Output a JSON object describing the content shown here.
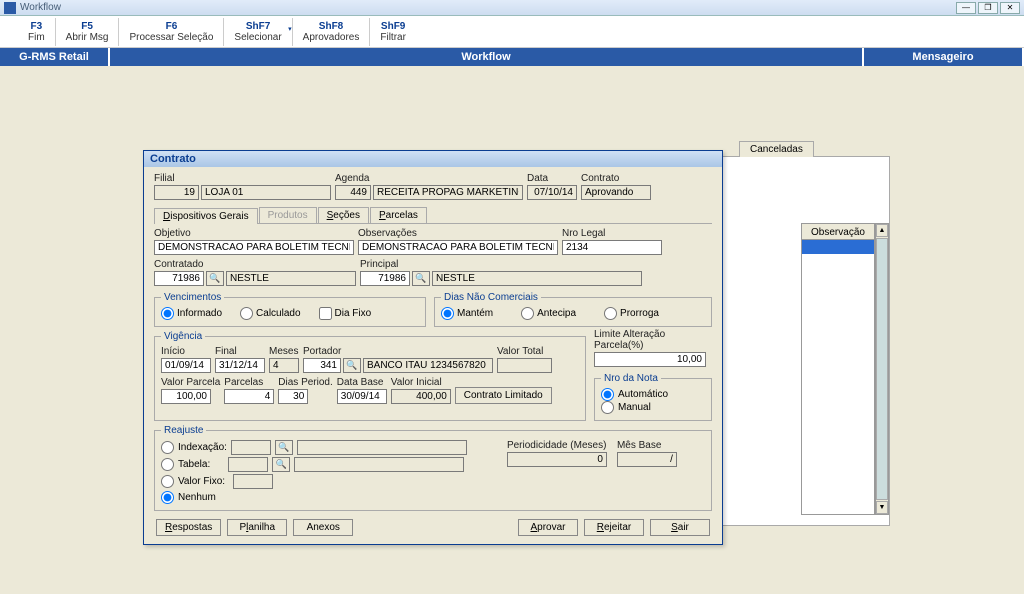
{
  "window": {
    "title": "Workflow"
  },
  "toolbar": [
    {
      "key": "F3",
      "label": "Fim"
    },
    {
      "key": "F5",
      "label": "Abrir Msg"
    },
    {
      "key": "F6",
      "label": "Processar Seleção"
    },
    {
      "key": "ShF7",
      "label": "Selecionar",
      "drop": true
    },
    {
      "key": "ShF8",
      "label": "Aprovadores"
    },
    {
      "key": "ShF9",
      "label": "Filtrar"
    }
  ],
  "bluebar": {
    "left": "G-RMS Retail",
    "middle": "Workflow",
    "right": "Mensageiro"
  },
  "bg": {
    "tab": "Canceladas",
    "col": "Observação"
  },
  "dialog": {
    "title": "Contrato",
    "header": {
      "filial_label": "Filial",
      "filial_code": "19",
      "filial_name": "LOJA 01",
      "agenda_label": "Agenda",
      "agenda_code": "449",
      "agenda_name": "RECEITA PROPAG MARKETING",
      "data_label": "Data",
      "data_value": "07/10/14",
      "contrato_label": "Contrato",
      "contrato_value": "Aprovando"
    },
    "tabs": {
      "t1": "Dispositivos Gerais",
      "t2": "Produtos",
      "t3": "Seções",
      "t4": "Parcelas"
    },
    "main": {
      "objetivo_label": "Objetivo",
      "objetivo": "DEMONSTRACAO PARA BOLETIM TECNICO",
      "obs_label": "Observações",
      "obs": "DEMONSTRACAO PARA BOLETIM TECNICO",
      "nrolegal_label": "Nro Legal",
      "nrolegal": "2134",
      "contratado_label": "Contratado",
      "contratado_code": "71986",
      "contratado_name": "NESTLE",
      "principal_label": "Principal",
      "principal_code": "71986",
      "principal_name": "NESTLE"
    },
    "venc": {
      "legend": "Vencimentos",
      "informado": "Informado",
      "calculado": "Calculado",
      "diafixo": "Dia Fixo"
    },
    "dnc": {
      "legend": "Dias Não Comerciais",
      "mantem": "Mantém",
      "antecipa": "Antecipa",
      "prorroga": "Prorroga"
    },
    "vig": {
      "legend": "Vigência",
      "inicio_label": "Início",
      "inicio": "01/09/14",
      "final_label": "Final",
      "final": "31/12/14",
      "meses_label": "Meses",
      "meses": "4",
      "portador_label": "Portador",
      "portador_code": "341",
      "portador_name": "BANCO ITAU 1234567820",
      "valortotal_label": "Valor Total",
      "valortotal": "",
      "valorparcela_label": "Valor Parcela",
      "valorparcela": "100,00",
      "parcelas_label": "Parcelas",
      "parcelas": "4",
      "diasperiod_label": "Dias Period.",
      "diasperiod": "30",
      "database_label": "Data Base",
      "database": "30/09/14",
      "valorinicial_label": "Valor Inicial",
      "valorinicial": "400,00",
      "contratolimitado": "Contrato Limitado"
    },
    "side": {
      "limite_label": "Limite Alteração Parcela(%)",
      "limite": "10,00",
      "nronota_legend": "Nro da Nota",
      "automatico": "Automático",
      "manual": "Manual"
    },
    "reaj": {
      "legend": "Reajuste",
      "indexacao": "Indexação:",
      "tabela": "Tabela:",
      "valorfixo": "Valor Fixo:",
      "nenhum": "Nenhum",
      "period_label": "Periodicidade (Meses)",
      "period": "0",
      "mesbase_label": "Mês Base",
      "mesbase": "/"
    },
    "buttons": {
      "respostas": "Respostas",
      "planilha": "Planilha",
      "anexos": "Anexos",
      "aprovar": "Aprovar",
      "rejeitar": "Rejeitar",
      "sair": "Sair"
    }
  }
}
